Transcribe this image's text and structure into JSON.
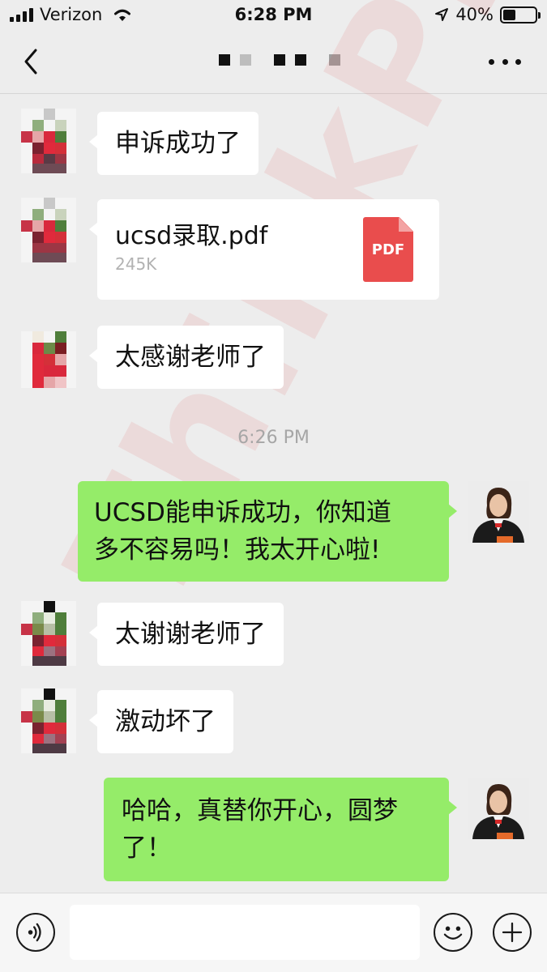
{
  "status_bar": {
    "carrier": "Verizon",
    "time": "6:28 PM",
    "battery_percent": "40%",
    "battery_level": 0.4
  },
  "nav": {
    "back_icon": "chevron-left-icon",
    "more_icon": "more-dots-icon"
  },
  "messages": [
    {
      "type": "incoming-text",
      "text": "申诉成功了"
    },
    {
      "type": "incoming-file",
      "file_name": "ucsd录取.pdf",
      "file_size": "245K",
      "file_icon_label": "PDF"
    },
    {
      "type": "incoming-text",
      "text": "太感谢老师了"
    },
    {
      "type": "timestamp",
      "text": "6:26 PM"
    },
    {
      "type": "outgoing-text",
      "lines": [
        "UCSD能申诉成功，你知道",
        "多不容易吗！我太开心啦!"
      ]
    },
    {
      "type": "incoming-text",
      "text": "太谢谢老师了"
    },
    {
      "type": "incoming-text",
      "text": "激动坏了"
    },
    {
      "type": "outgoing-text",
      "lines": [
        "哈哈，真替你开心，圆梦",
        "了！"
      ]
    }
  ],
  "watermark": "ThinkPro",
  "input_bar": {
    "voice_icon": "voice-icon",
    "emoji_icon": "emoji-icon",
    "plus_icon": "plus-icon",
    "input_value": ""
  },
  "colors": {
    "background": "#ededed",
    "outgoing_bubble": "#95ec69",
    "incoming_bubble": "#ffffff",
    "pdf_icon": "#e94d4d",
    "watermark": "#e63c3c"
  }
}
